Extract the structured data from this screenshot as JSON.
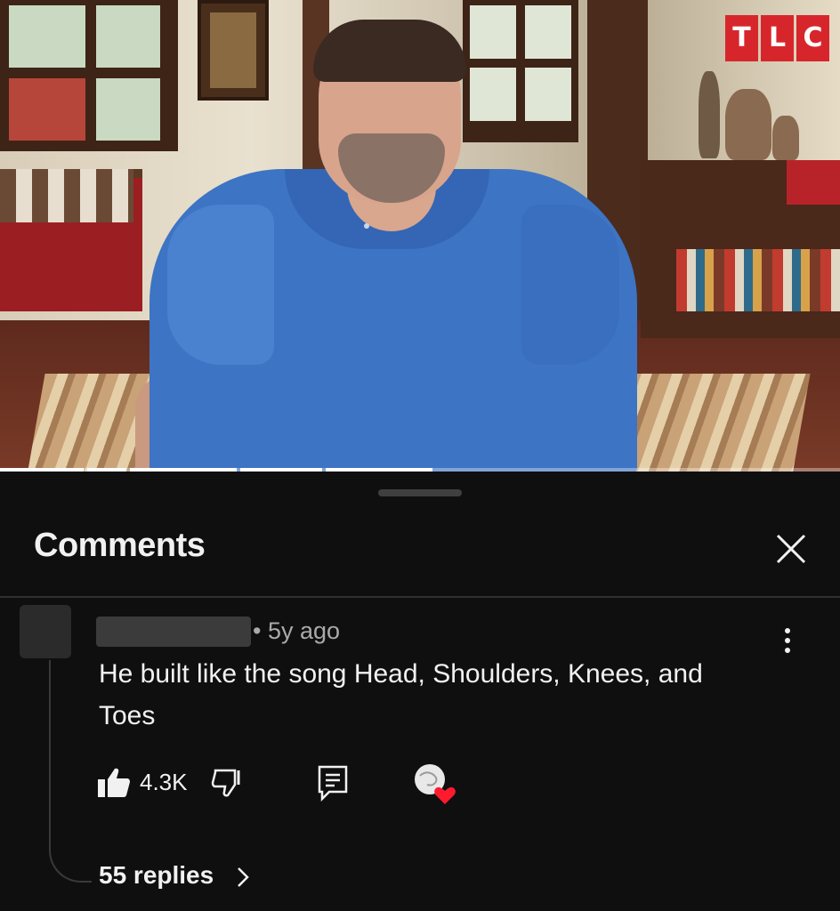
{
  "video": {
    "channel_logo_letters": [
      "T",
      "L",
      "C"
    ],
    "logo_color": "#d7262b",
    "shirt_color": "#3d74c4"
  },
  "comments_sheet": {
    "title": "Comments",
    "close_icon": "close-icon",
    "comment": {
      "author": "",
      "meta": "• 5y ago",
      "text": "He built like the song Head, Shoulders, Knees, and Toes",
      "like_count": "4.3K",
      "icons": [
        "like-icon",
        "dislike-icon",
        "reply-icon",
        "creator-heart-icon",
        "more-vert-icon"
      ],
      "replies_label": "55 replies"
    }
  }
}
